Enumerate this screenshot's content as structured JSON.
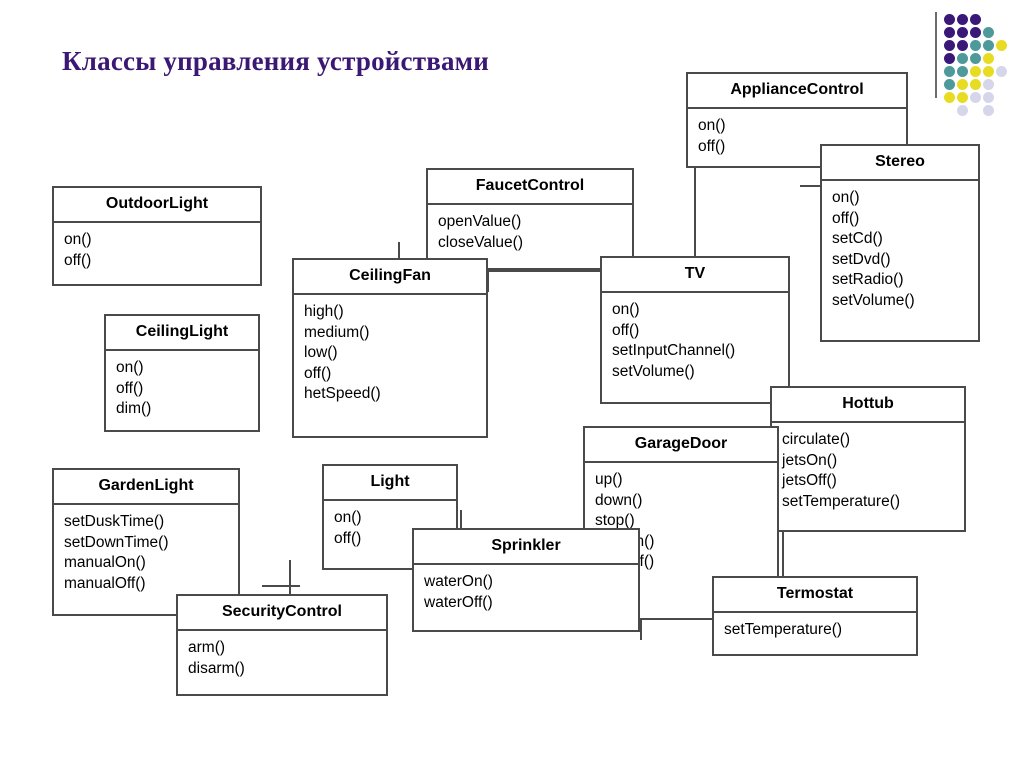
{
  "page": {
    "title": "Классы управления устройствами",
    "title_color": "#3A1873",
    "background": "#ffffff",
    "border_color": "#4a4a4a"
  },
  "logo": {
    "name": "decorative-dot-grid",
    "colors": {
      "purple": "#3A1878",
      "teal": "#4E9A9A",
      "yellow": "#E8DC23",
      "lavender": "#D6D6EA"
    },
    "rows": [
      [
        "purple",
        "purple",
        "purple",
        "none",
        "none"
      ],
      [
        "purple",
        "purple",
        "purple",
        "teal",
        "none"
      ],
      [
        "purple",
        "purple",
        "teal",
        "teal",
        "yellow"
      ],
      [
        "purple",
        "teal",
        "teal",
        "yellow",
        "none"
      ],
      [
        "teal",
        "teal",
        "yellow",
        "yellow",
        "lavender"
      ],
      [
        "teal",
        "yellow",
        "yellow",
        "lavender",
        "none"
      ],
      [
        "yellow",
        "yellow",
        "lavender",
        "lavender",
        "none"
      ],
      [
        "none",
        "lavender",
        "none",
        "lavender",
        "none"
      ]
    ]
  },
  "classes": [
    {
      "id": "appliance-control",
      "name": "ApplianceControl",
      "operations": [
        "on()",
        "off()"
      ]
    },
    {
      "id": "stereo",
      "name": "Stereo",
      "operations": [
        "on()",
        "off()",
        "setCd()",
        "setDvd()",
        "setRadio()",
        "setVolume()"
      ]
    },
    {
      "id": "outdoor-light",
      "name": "OutdoorLight",
      "operations": [
        "on()",
        "off()"
      ]
    },
    {
      "id": "faucet-control",
      "name": "FaucetControl",
      "operations": [
        "openValue()",
        "closeValue()"
      ]
    },
    {
      "id": "ceiling-light",
      "name": "CeilingLight",
      "operations": [
        "on()",
        "off()",
        "dim()"
      ]
    },
    {
      "id": "ceiling-fan",
      "name": "CeilingFan",
      "operations": [
        "high()",
        "medium()",
        "low()",
        "off()",
        "hetSpeed()"
      ]
    },
    {
      "id": "tv",
      "name": "TV",
      "operations": [
        "on()",
        "off()",
        "setInputChannel()",
        "setVolume()"
      ]
    },
    {
      "id": "hottub",
      "name": "Hottub",
      "operations": [
        "circulate()",
        "jetsOn()",
        "jetsOff()",
        "setTemperature()"
      ]
    },
    {
      "id": "garden-light",
      "name": "GardenLight",
      "operations": [
        "setDuskTime()",
        "setDownTime()",
        "manualOn()",
        "manualOff()"
      ]
    },
    {
      "id": "light",
      "name": "Light",
      "operations": [
        "on()",
        "off()"
      ]
    },
    {
      "id": "garage-door",
      "name": "GarageDoor",
      "operations": [
        "up()",
        "down()",
        "stop()",
        "lightOn()",
        "lightOff()"
      ]
    },
    {
      "id": "sprinkler",
      "name": "Sprinkler",
      "operations": [
        "waterOn()",
        "waterOff()"
      ]
    },
    {
      "id": "security-control",
      "name": "SecurityControl",
      "operations": [
        "arm()",
        "disarm()"
      ]
    },
    {
      "id": "termostat",
      "name": "Termostat",
      "operations": [
        "setTemperature()"
      ]
    }
  ]
}
